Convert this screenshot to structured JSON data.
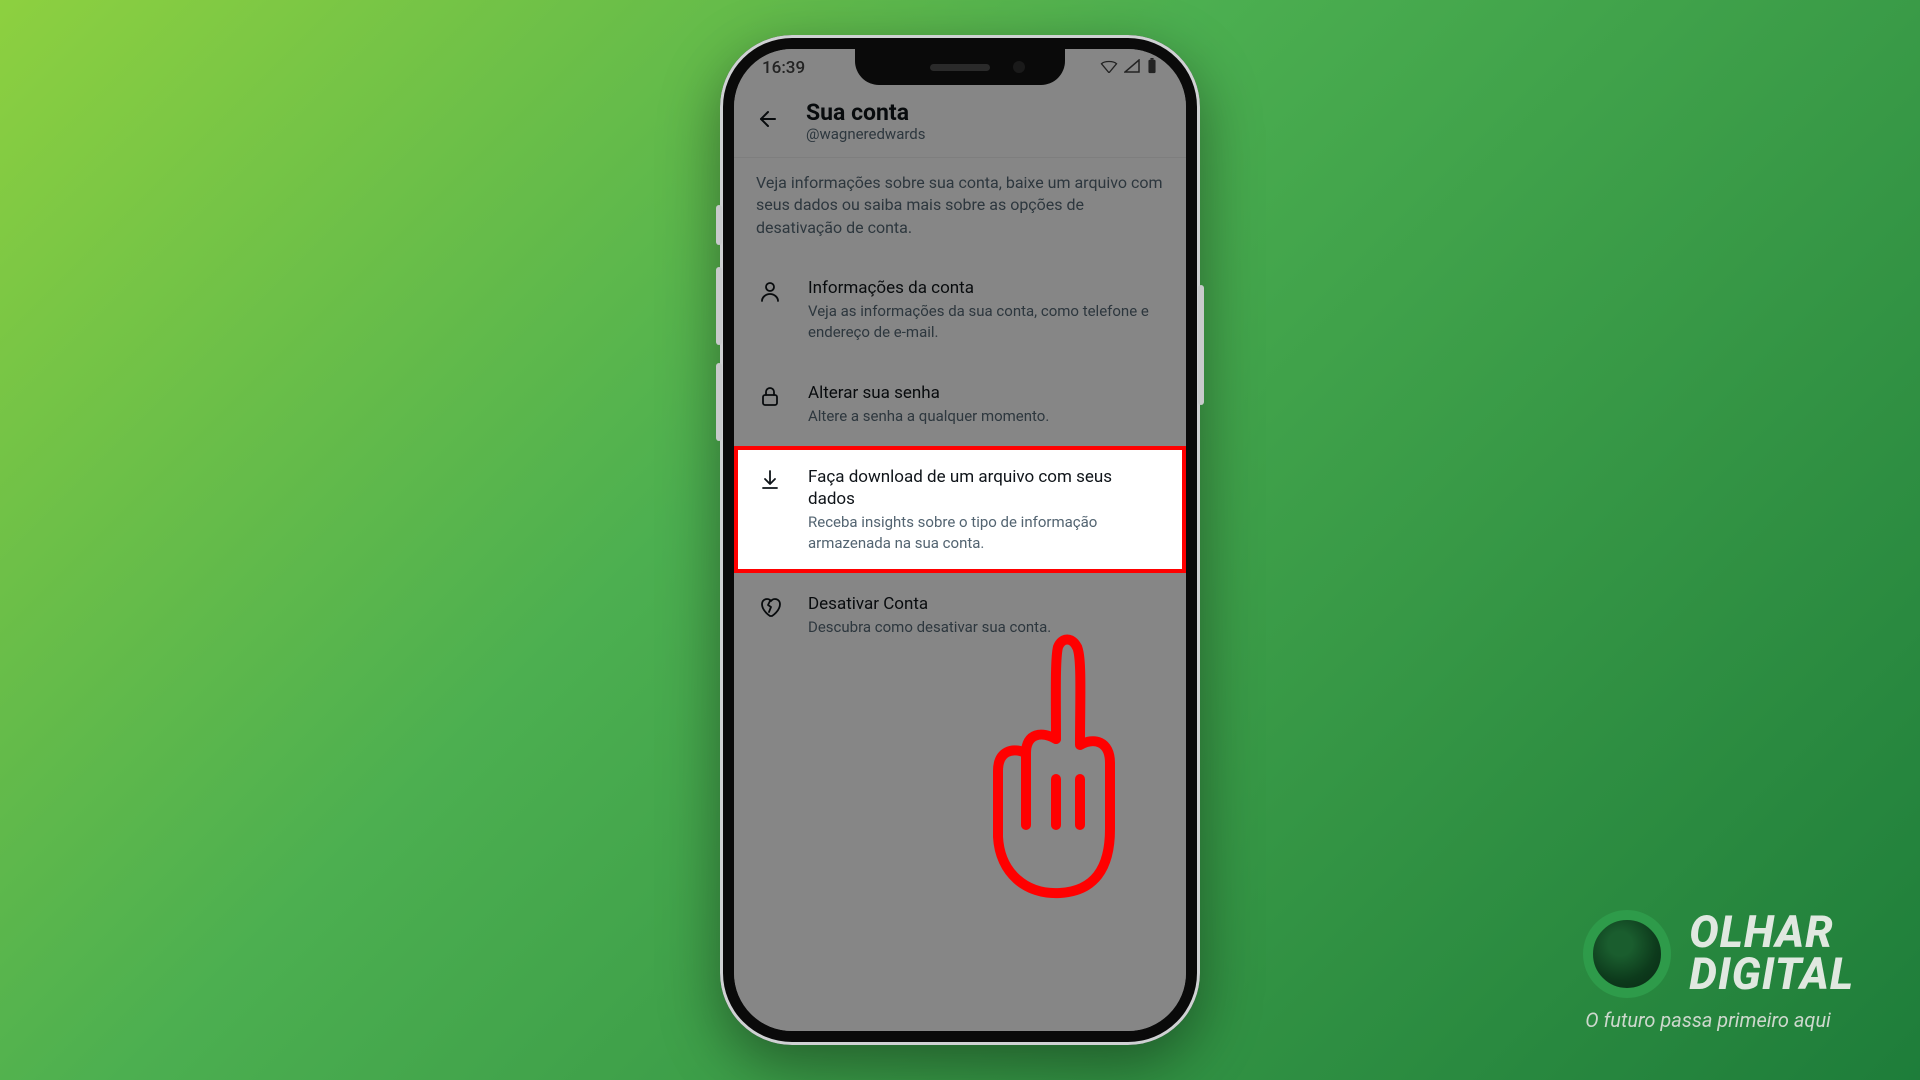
{
  "statusbar": {
    "time": "16:39"
  },
  "header": {
    "title": "Sua conta",
    "subtitle": "@wagneredwards"
  },
  "intro": "Veja informações sobre sua conta, baixe um arquivo com seus dados ou saiba mais sobre as opções de desativação de conta.",
  "options": {
    "account_info": {
      "title": "Informações da conta",
      "desc": "Veja as informações da sua conta, como telefone e endereço de e-mail."
    },
    "change_pw": {
      "title": "Alterar sua senha",
      "desc": "Altere a senha a qualquer momento."
    },
    "download": {
      "title": "Faça download de um arquivo com seus dados",
      "desc": "Receba insights sobre o tipo de informação armazenada na sua conta."
    },
    "deactivate": {
      "title": "Desativar Conta",
      "desc": "Descubra como desativar sua conta."
    }
  },
  "logo": {
    "line1": "OLHAR",
    "line2": "DIGITAL",
    "tagline": "O futuro passa primeiro aqui"
  }
}
